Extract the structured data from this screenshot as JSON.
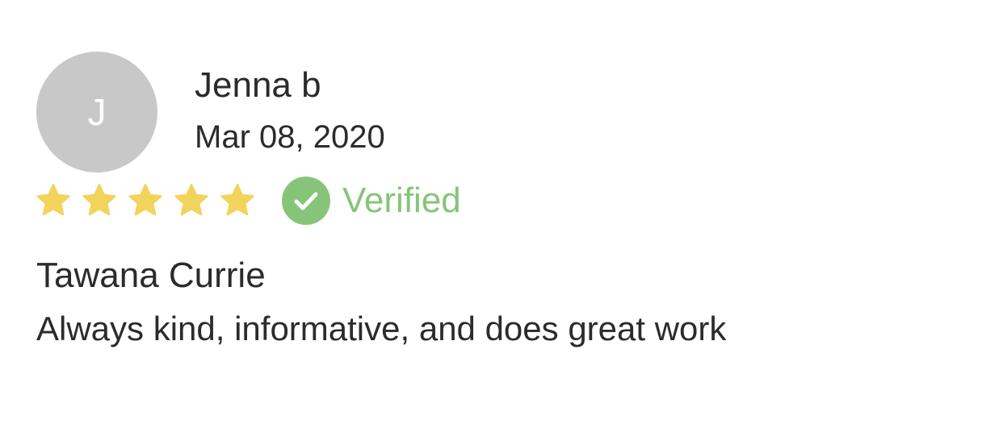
{
  "review": {
    "avatar_initial": "J",
    "reviewer_name": "Jenna b",
    "date": "Mar 08, 2020",
    "rating": 5,
    "rating_max": 5,
    "star_icon": "star-icon",
    "verified_icon": "check-circle-icon",
    "verified_label": "Verified",
    "title": "Tawana Currie",
    "body": "Always kind, informative, and does great work"
  },
  "colors": {
    "avatar_bg": "#c8c8c8",
    "star": "#f2d45c",
    "verified": "#86c579",
    "text": "#2b2b2b"
  }
}
